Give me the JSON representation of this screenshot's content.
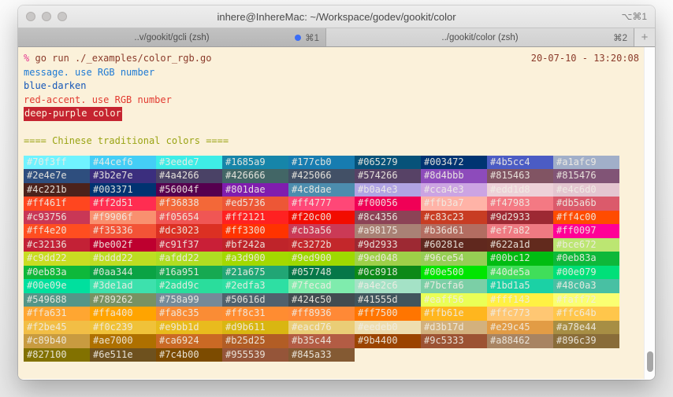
{
  "window": {
    "title": "inhere@InhereMac: ~/Workspace/godev/gookit/color",
    "title_shortcut": "⌥⌘1",
    "tabs": [
      {
        "label": "..v/gookit/gcli (zsh)",
        "shortcut": "⌘1",
        "active": false,
        "activity_dot": true,
        "dot_color": "#3b6df6"
      },
      {
        "label": "../gookit/color (zsh)",
        "shortcut": "⌘2",
        "active": true,
        "activity_dot": false
      }
    ],
    "new_tab_label": "+"
  },
  "terminal": {
    "background": "#fbf1da",
    "prompt_symbol": "%",
    "prompt_color": "#e3368d",
    "command": "go run ./_examples/color_rgb.go",
    "command_color": "#8a3a2a",
    "timestamp": "20-07-10 - 13:20:08",
    "lines": [
      {
        "text": "message. use RGB number",
        "color": "#1e7ad4"
      },
      {
        "text": "blue-darken",
        "color": "#1557b8"
      },
      {
        "text": "red-accent. use RGB number",
        "color": "#e23b31"
      },
      {
        "text": "deep-purple color",
        "color": "#fdf4de",
        "bg": "#c52430"
      }
    ],
    "heading": "==== Chinese traditional colors ====",
    "heading_color": "#9aa414",
    "palette": [
      [
        "#70f3ff",
        "#44cef6",
        "#3eede7",
        "#1685a9",
        "#177cb0",
        "#065279",
        "#003472",
        "#4b5cc4",
        "#a1afc9"
      ],
      [
        "#2e4e7e",
        "#3b2e7e",
        "#4a4266",
        "#426666",
        "#425066",
        "#574266",
        "#8d4bbb",
        "#815463",
        "#815476"
      ],
      [
        "#4c221b",
        "#003371",
        "#56004f",
        "#801dae",
        "#4c8dae",
        "#b0a4e3",
        "#cca4e3",
        "#edd1d8",
        "#e4c6d0"
      ],
      [
        "#ff461f",
        "#ff2d51",
        "#f36838",
        "#ed5736",
        "#ff4777",
        "#f00056",
        "#ffb3a7",
        "#f47983",
        "#db5a6b"
      ],
      [
        "#c93756",
        "#f9906f",
        "#f05654",
        "#ff2121",
        "#f20c00",
        "#8c4356",
        "#c83c23",
        "#9d2933",
        "#ff4c00"
      ],
      [
        "#ff4e20",
        "#f35336",
        "#dc3023",
        "#ff3300",
        "#cb3a56",
        "#a98175",
        "#b36d61",
        "#ef7a82",
        "#ff0097"
      ],
      [
        "#c32136",
        "#be002f",
        "#c91f37",
        "#bf242a",
        "#c3272b",
        "#9d2933",
        "#60281e",
        "#622a1d",
        "#bce672"
      ],
      [
        "#c9dd22",
        "#bddd22",
        "#afdd22",
        "#a3d900",
        "#9ed900",
        "#9ed048",
        "#96ce54",
        "#00bc12",
        "#0eb83a"
      ],
      [
        "#0eb83a",
        "#0aa344",
        "#16a951",
        "#21a675",
        "#057748",
        "#0c8918",
        "#00e500",
        "#40de5a",
        "#00e079"
      ],
      [
        "#00e09e",
        "#3de1ad",
        "#2add9c",
        "#2edfa3",
        "#7fecad",
        "#a4e2c6",
        "#7bcfa6",
        "#1bd1a5",
        "#48c0a3"
      ],
      [
        "#549688",
        "#789262",
        "#758a99",
        "#50616d",
        "#424c50",
        "#41555d",
        "#eaff56",
        "#fff143",
        "#faff72"
      ],
      [
        "#ffa631",
        "#ffa400",
        "#fa8c35",
        "#ff8c31",
        "#ff8936",
        "#ff7500",
        "#ffb61e",
        "#ffc773",
        "#ffc64b"
      ],
      [
        "#f2be45",
        "#f0c239",
        "#e9bb1d",
        "#d9b611",
        "#eacd76",
        "#eedeb0",
        "#d3b17d",
        "#e29c45",
        "#a78e44"
      ],
      [
        "#c89b40",
        "#ae7000",
        "#ca6924",
        "#b25d25",
        "#b35c44",
        "#9b4400",
        "#9c5333",
        "#a88462",
        "#896c39"
      ],
      [
        "#827100",
        "#6e511e",
        "#7c4b00",
        "#955539",
        "#845a33"
      ]
    ]
  }
}
